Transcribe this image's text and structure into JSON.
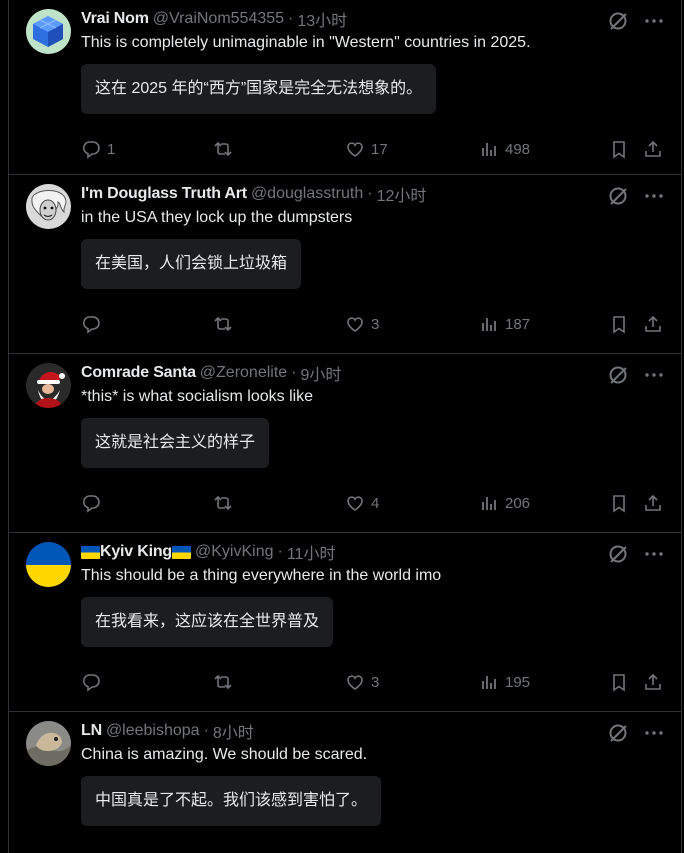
{
  "tweets": [
    {
      "name": "Vrai Nom",
      "handle": "@VraiNom554355",
      "time": "13小时",
      "text": "This is completely unimaginable in \"Western\" countries in 2025.",
      "translation": "这在 2025 年的“西方”国家是完全无法想象的。",
      "replies": "1",
      "retweets": "",
      "likes": "17",
      "views": "498"
    },
    {
      "name": "I'm Douglass Truth Art",
      "handle": "@douglasstruth",
      "time": "12小时",
      "text": "in the USA they lock up the dumpsters",
      "translation": "在美国，人们会锁上垃圾箱",
      "replies": "",
      "retweets": "",
      "likes": "3",
      "views": "187"
    },
    {
      "name": "Comrade Santa",
      "handle": "@Zeronelite",
      "time": "9小时",
      "text": "*this* is what socialism looks like",
      "translation": "这就是社会主义的样子",
      "replies": "",
      "retweets": "",
      "likes": "4",
      "views": "206"
    },
    {
      "name": "Kyiv King",
      "handle": "@KyivKing",
      "time": "11小时",
      "text": "This should be a thing everywhere in the world imo",
      "translation": "在我看来，这应该在全世界普及",
      "replies": "",
      "retweets": "",
      "likes": "3",
      "views": "195"
    },
    {
      "name": "LN",
      "handle": "@leebishopa",
      "time": "8小时",
      "text": "China is amazing. We should be scared.",
      "translation": "中国真是了不起。我们该感到害怕了。"
    }
  ],
  "separator": "·",
  "colors": {
    "background": "#000000",
    "text": "#e7e9ea",
    "muted": "#71767b",
    "border": "#2f3336",
    "translation_bg": "#1c1d1f"
  },
  "icons": [
    "grok-icon",
    "more-icon",
    "reply-icon",
    "retweet-icon",
    "like-icon",
    "views-icon",
    "bookmark-icon",
    "share-icon"
  ]
}
